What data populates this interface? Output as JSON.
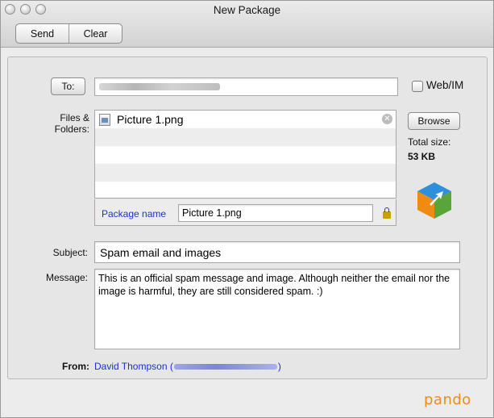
{
  "window": {
    "title": "New Package"
  },
  "toolbar": {
    "send_label": "Send",
    "clear_label": "Clear"
  },
  "to": {
    "button_label": "To:",
    "webim_label": "Web/IM",
    "webim_checked": false
  },
  "files": {
    "label": "Files & Folders:",
    "items": [
      {
        "name": "Picture 1.png"
      }
    ],
    "browse_label": "Browse",
    "total_size_label": "Total size:",
    "total_size_value": "53 KB",
    "package_name_label": "Package name",
    "package_name_value": "Picture 1.png"
  },
  "subject": {
    "label": "Subject:",
    "value": "Spam email and images"
  },
  "message": {
    "label": "Message:",
    "value": "This is an official spam message and image. Although neither the email nor the image is harmful, they are still considered spam. :)"
  },
  "from": {
    "label": "From:",
    "name": "David Thompson (",
    "close": ")"
  },
  "brand": {
    "name": "pando",
    "color": "#f08a18"
  },
  "icons": [
    "file-icon",
    "remove-icon",
    "lock-icon",
    "pando-logo-icon"
  ]
}
